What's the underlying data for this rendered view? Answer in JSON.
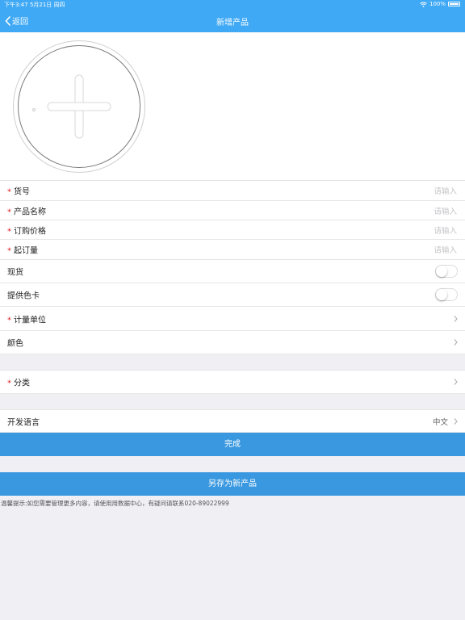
{
  "status_bar": {
    "time_date": "下午3:47  5月21日 周四",
    "battery": "100%"
  },
  "nav": {
    "back_label": "返回",
    "title": "新增产品"
  },
  "fields": [
    {
      "label": "货号",
      "required": "*",
      "placeholder": "请输入"
    },
    {
      "label": "产品名称",
      "required": "*",
      "placeholder": "请输入"
    },
    {
      "label": "订购价格",
      "required": "*",
      "placeholder": "请输入"
    },
    {
      "label": "起订量",
      "required": "*",
      "placeholder": "请输入"
    }
  ],
  "toggles": [
    {
      "label": "现货",
      "on": false
    },
    {
      "label": "提供色卡",
      "on": false
    }
  ],
  "links": {
    "unit": {
      "label": "计量单位",
      "required": "*"
    },
    "color": {
      "label": "颜色"
    },
    "category": {
      "label": "分类",
      "required": "*"
    },
    "language": {
      "label": "开发语言",
      "value": "中文"
    }
  },
  "buttons": {
    "done": "完成",
    "save_as_new": "另存为新产品"
  },
  "tip": "温馨提示:如您需要管理更多内容，请使用用数据中心，有疑问请联系020-89022999",
  "colors": {
    "accent": "#3fa9f5",
    "button": "#3998e0",
    "required": "#e02020"
  }
}
